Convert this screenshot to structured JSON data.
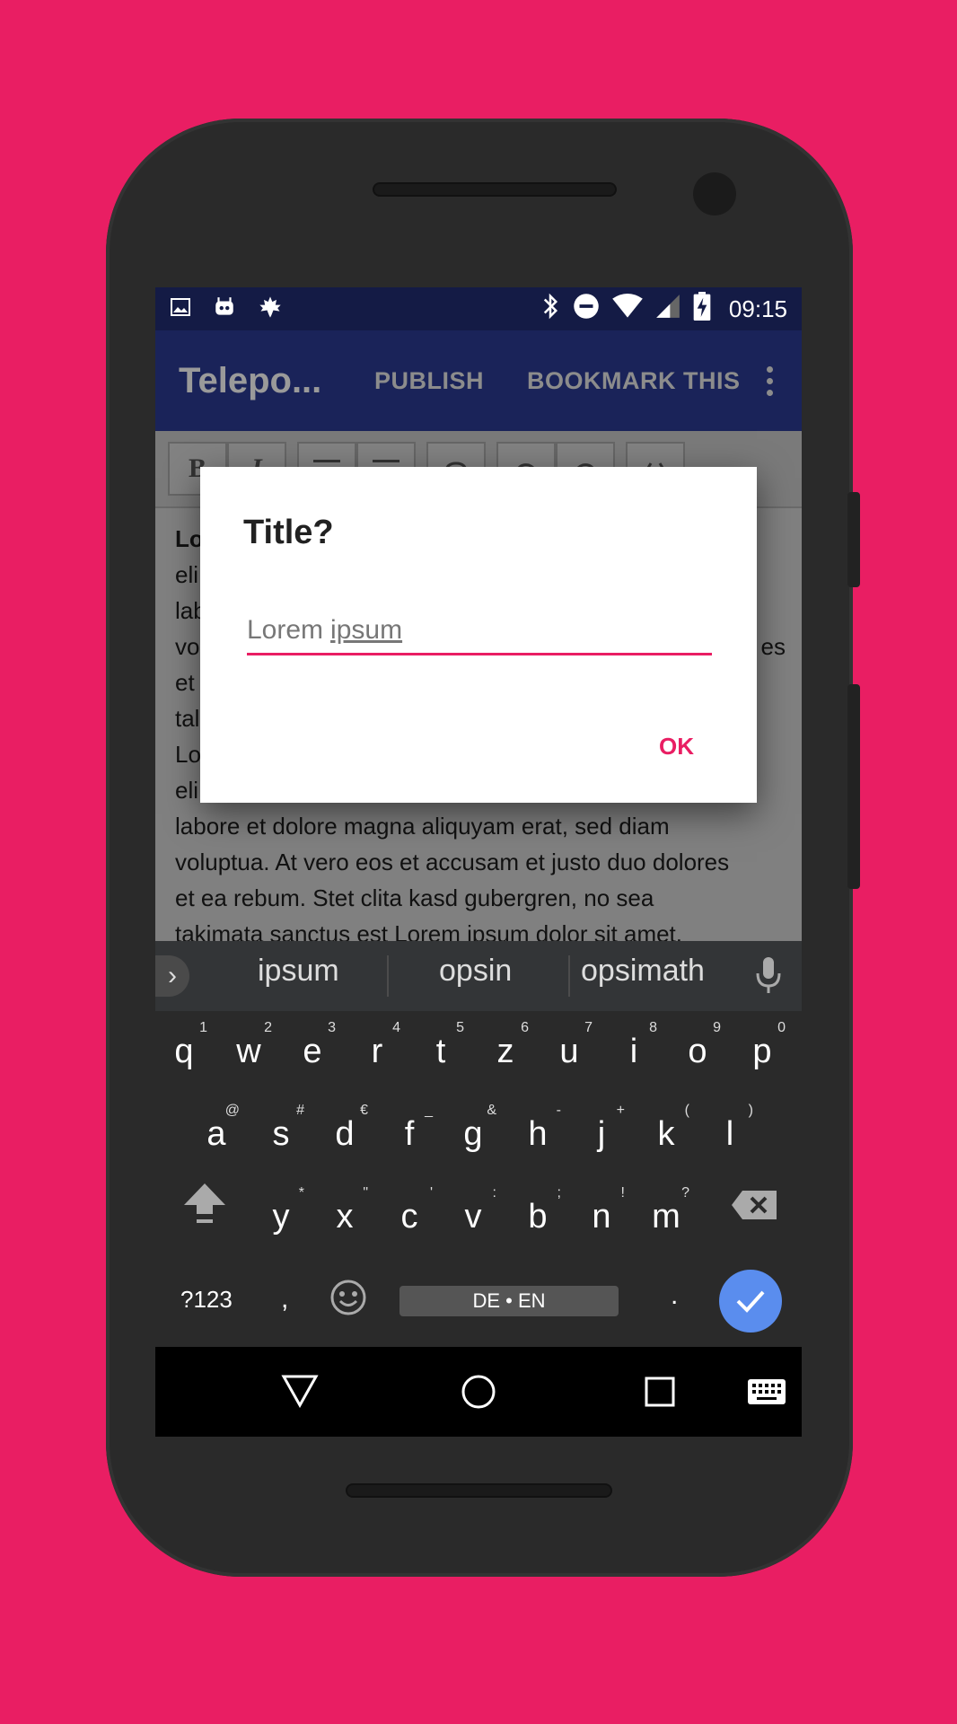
{
  "status_bar": {
    "time": "09:15"
  },
  "app_bar": {
    "title": "Telepo...",
    "publish": "PUBLISH",
    "bookmark": "BOOKMARK THIS"
  },
  "toolbar": {
    "bold": "B",
    "italic": "I"
  },
  "editor": {
    "lines": [
      "Lo",
      "eli",
      "lab",
      "vo",
      "et",
      "tal",
      "Lo",
      "eli",
      "labore et dolore magna aliquyam erat, sed diam",
      "voluptua. At vero eos et accusam et justo duo dolores",
      "et ea rebum. Stet clita kasd gubergren, no sea",
      "takimata sanctus est Lorem ipsum dolor sit amet."
    ],
    "right_fragment": "es"
  },
  "dialog": {
    "title": "Title?",
    "input_word1": "Lorem",
    "input_word2": "ipsum",
    "ok": "OK"
  },
  "suggestions": [
    "ipsum",
    "opsin",
    "opsimath"
  ],
  "keyboard": {
    "row1": [
      [
        "q",
        "1"
      ],
      [
        "w",
        "2"
      ],
      [
        "e",
        "3"
      ],
      [
        "r",
        "4"
      ],
      [
        "t",
        "5"
      ],
      [
        "z",
        "6"
      ],
      [
        "u",
        "7"
      ],
      [
        "i",
        "8"
      ],
      [
        "o",
        "9"
      ],
      [
        "p",
        "0"
      ]
    ],
    "row2": [
      [
        "a",
        "@"
      ],
      [
        "s",
        "#"
      ],
      [
        "d",
        "€"
      ],
      [
        "f",
        "_"
      ],
      [
        "g",
        "&"
      ],
      [
        "h",
        "-"
      ],
      [
        "j",
        "+"
      ],
      [
        "k",
        "("
      ],
      [
        "l",
        ")"
      ]
    ],
    "row3": [
      [
        "y",
        "*"
      ],
      [
        "x",
        "\""
      ],
      [
        "c",
        "'"
      ],
      [
        "v",
        ":"
      ],
      [
        "b",
        ";"
      ],
      [
        "n",
        "!"
      ],
      [
        "m",
        "?"
      ]
    ],
    "symbols": "?123",
    "comma": ",",
    "space": "DE • EN",
    "period": "."
  }
}
